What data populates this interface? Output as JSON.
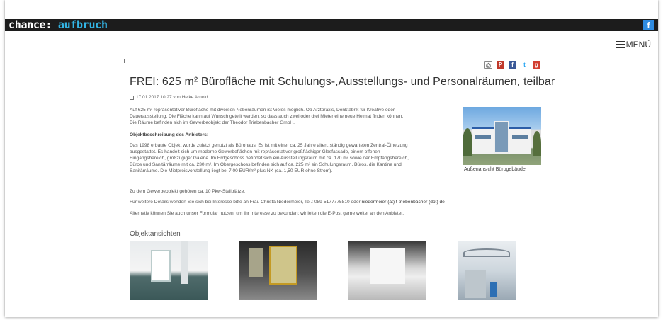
{
  "header": {
    "logo_part1": "chance: ",
    "logo_part2": "aufbruch",
    "facebook_label": "f",
    "menu_label": "MENÜ"
  },
  "share_icons": [
    "print-icon",
    "pdf-icon",
    "facebook-icon",
    "twitter-icon",
    "googleplus-icon"
  ],
  "article": {
    "title": "FREI: 625 m² Bürofläche mit Schulungs-,Ausstellungs- und Personalräumen, teilbar",
    "meta": "17.01.2017 10:27 von Heike Arnold",
    "intro_lines": [
      "Auf 625 m² repräsentativer Bürofläche mit diversen Nebenräumen ist Vieles möglich. Ob Arztpraxis, Denkfabrik für Kreative oder",
      "Dauerausstellung. Die Fläche kann auf Wunsch geteilt werden, so dass auch zwei oder drei Mieter eine neue Heimat finden können.",
      "Die Räume befinden sich im Gewerbeobjekt der Theodor Triebenbacher GmbH."
    ],
    "subheading": "Objektbeschreibung des Anbieters:",
    "description_lines": [
      "Das 1998 erbaute Objekt wurde zuletzt genutzt als Bürohaus. Es ist mit einer ca. 25 Jahre alten, ständig gewarteten Zentral-Ölheizung",
      "ausgestattet. Es handelt sich um moderne Gewerbeflächen mit repräsentativer großflächiger Glasfassade, einem offenen",
      "Eingangsbereich, großzügiger Galerie. Im Erdgeschoss befindet sich ein Ausstellungsraum mit ca. 170 m² sowie der Empfangsbereich,",
      "Büros und Sanitärräume mit ca. 230 m². Im Obergeschoss befinden sich auf ca. 225 m² ein Schulungsraum, Büros, die Kantine und",
      "Sanitärräume. Die Mietpreisvorstellung liegt bei 7,00 EUR/m² plus NK (ca. 1,50 EUR ohne Strom)."
    ],
    "parking": "Zu dem Gewerbeobjekt gehören ca. 10 Pkw-Stellplätze.",
    "contact_text": "Für weitere Details wenden Sie sich bei Interesse bitte an Frau Christa Niedermeier, Tel.: 089-5177775810 oder ",
    "contact_email": "niedermeier (at) t-triebenbacher (dot) de",
    "form_text": "Alternativ können Sie auch unser Formular nutzen, um Ihr Interesse zu bekunden: wir leiten die E-Post gerne weiter an den Anbieter.",
    "hero_caption": "Außenansicht Bürogebäude",
    "gallery_heading": "Objektansichten"
  }
}
